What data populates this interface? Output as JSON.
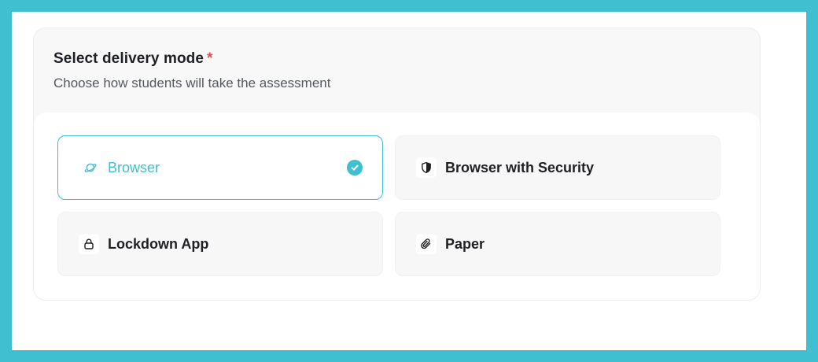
{
  "form": {
    "title": "Select delivery mode",
    "required_marker": "*",
    "subtitle": "Choose how students will take the assessment"
  },
  "options": [
    {
      "label": "Browser",
      "icon": "planet-icon",
      "selected": true
    },
    {
      "label": "Browser with Security",
      "icon": "shield-icon",
      "selected": false
    },
    {
      "label": "Lockdown App",
      "icon": "lock-icon",
      "selected": false
    },
    {
      "label": "Paper",
      "icon": "paperclip-icon",
      "selected": false
    }
  ],
  "colors": {
    "accent": "#40bfd1",
    "required": "#e5484d",
    "frame": "#40bfd1"
  }
}
